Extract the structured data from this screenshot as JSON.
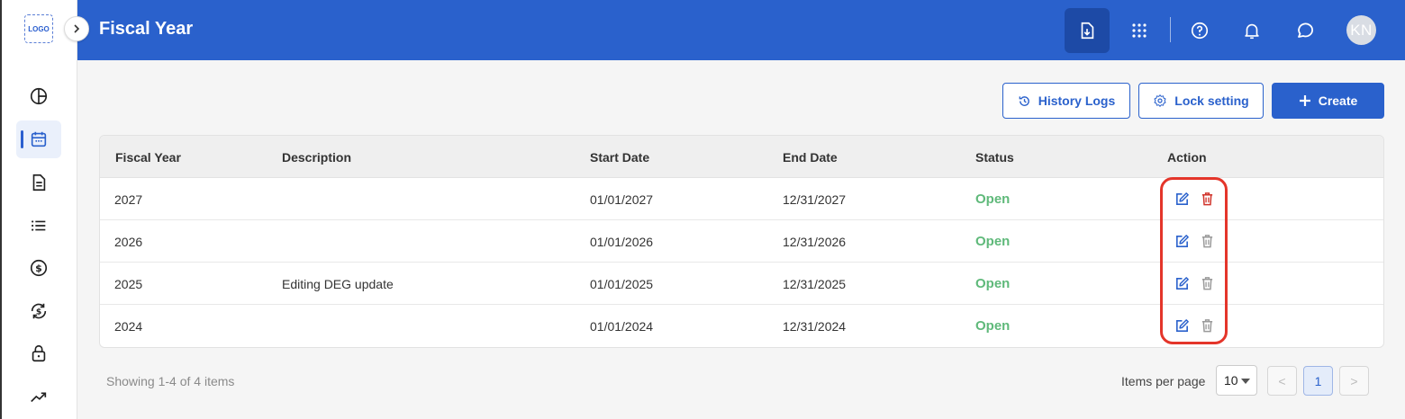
{
  "sidebar": {
    "logo_text": "LOGO",
    "items": [
      {
        "icon": "pie-chart-icon"
      },
      {
        "icon": "calendar-icon",
        "active": true
      },
      {
        "icon": "document-icon"
      },
      {
        "icon": "list-icon"
      },
      {
        "icon": "dollar-circle-icon"
      },
      {
        "icon": "currency-exchange-icon"
      },
      {
        "icon": "lock-icon"
      },
      {
        "icon": "trending-up-icon"
      }
    ]
  },
  "header": {
    "title": "Fiscal Year",
    "avatar_initials": "KN",
    "icons": [
      "download-doc-icon",
      "apps-grid-icon",
      "help-icon",
      "bell-icon",
      "chat-icon"
    ]
  },
  "toolbar": {
    "history_label": "History Logs",
    "lock_label": "Lock setting",
    "create_label": "Create"
  },
  "table": {
    "columns": [
      "Fiscal Year",
      "Description",
      "Start Date",
      "End Date",
      "Status",
      "Action"
    ],
    "rows": [
      {
        "fiscal_year": "2027",
        "description": "",
        "start_date": "01/01/2027",
        "end_date": "12/31/2027",
        "status": "Open"
      },
      {
        "fiscal_year": "2026",
        "description": "",
        "start_date": "01/01/2026",
        "end_date": "12/31/2026",
        "status": "Open"
      },
      {
        "fiscal_year": "2025",
        "description": "Editing DEG update",
        "start_date": "01/01/2025",
        "end_date": "12/31/2025",
        "status": "Open"
      },
      {
        "fiscal_year": "2024",
        "description": "",
        "start_date": "01/01/2024",
        "end_date": "12/31/2024",
        "status": "Open"
      }
    ]
  },
  "footer": {
    "showing_text": "Showing 1-4 of 4 items",
    "items_per_page_label": "Items per page",
    "items_per_page_value": "10",
    "current_page": "1",
    "prev_symbol": "<",
    "next_symbol": ">"
  },
  "colors": {
    "primary": "#2a61cc",
    "status_open": "#5fb97a",
    "delete_active": "#d0332a",
    "highlight": "#e4352a"
  }
}
